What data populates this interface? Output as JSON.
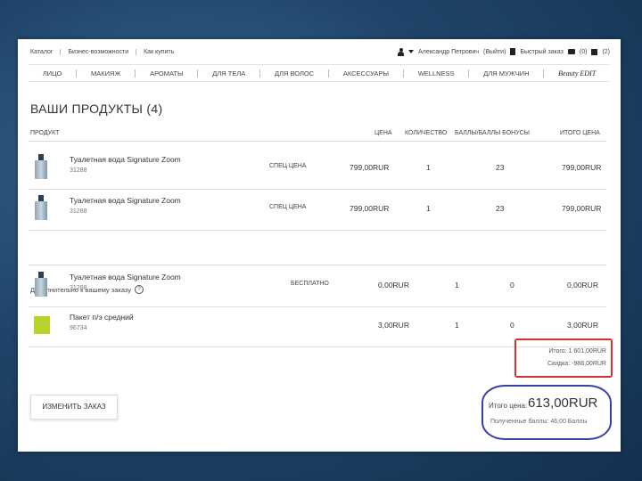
{
  "topbar": {
    "links": [
      "Каталог",
      "Бизнес-возможности",
      "Как купить"
    ],
    "user_name": "Александр Петрович",
    "logout": "(Выйти)",
    "quick_order": "Быстрый заказ",
    "messages": "(0)",
    "cart": "(2)"
  },
  "menu": [
    "ЛИЦО",
    "МАКИЯЖ",
    "АРОМАТЫ",
    "ДЛЯ ТЕЛА",
    "ДЛЯ ВОЛОС",
    "АКСЕССУАРЫ",
    "WELLNESS",
    "ДЛЯ МУЖЧИН",
    "Beauty EDIT"
  ],
  "page_title": "ВАШИ ПРОДУКТЫ (4)",
  "columns": {
    "product": "ПРОДУКТ",
    "price": "ЦЕНА",
    "qty": "КОЛИЧЕСТВО",
    "points": "БАЛЛЫ/БАЛЛЫ БОНУСЫ",
    "total": "ИТОГО ЦЕНА"
  },
  "products": [
    {
      "name": "Туалетная вода Signature Zoom",
      "code": "31288",
      "tag": "СПЕЦ ЦЕНА",
      "price": "799,00RUR",
      "qty": "1",
      "points": "23",
      "total": "799,00RUR"
    },
    {
      "name": "Туалетная вода Signature Zoom",
      "code": "31288",
      "tag": "СПЕЦ ЦЕНА",
      "price": "799,00RUR",
      "qty": "1",
      "points": "23",
      "total": "799,00RUR"
    }
  ],
  "extra_label": "Дополнительно к вашему заказу",
  "extras": [
    {
      "name": "Туалетная вода Signature Zoom",
      "code": "31288",
      "tag": "БЕСПЛАТНО",
      "price": "0,00RUR",
      "qty": "1",
      "points": "0",
      "total": "0,00RUR"
    },
    {
      "name": "Пакет п/э средний",
      "code": "96734",
      "tag": "",
      "price": "3,00RUR",
      "qty": "1",
      "points": "0",
      "total": "3,00RUR"
    }
  ],
  "summary": {
    "subtotal": "Итого: 1 601,00RUR",
    "discount": "Скидка: -988,00RUR"
  },
  "total": {
    "label": "Итого цена:",
    "value": "613,00RUR",
    "points": "Полученные баллы: 46,00 Баллы"
  },
  "edit_button": "ИЗМЕНИТЬ ЗАКАЗ",
  "colors": {
    "summary_circle": "#d63030",
    "total_circle": "#3a3fa8",
    "bag": "#b8d42a"
  }
}
